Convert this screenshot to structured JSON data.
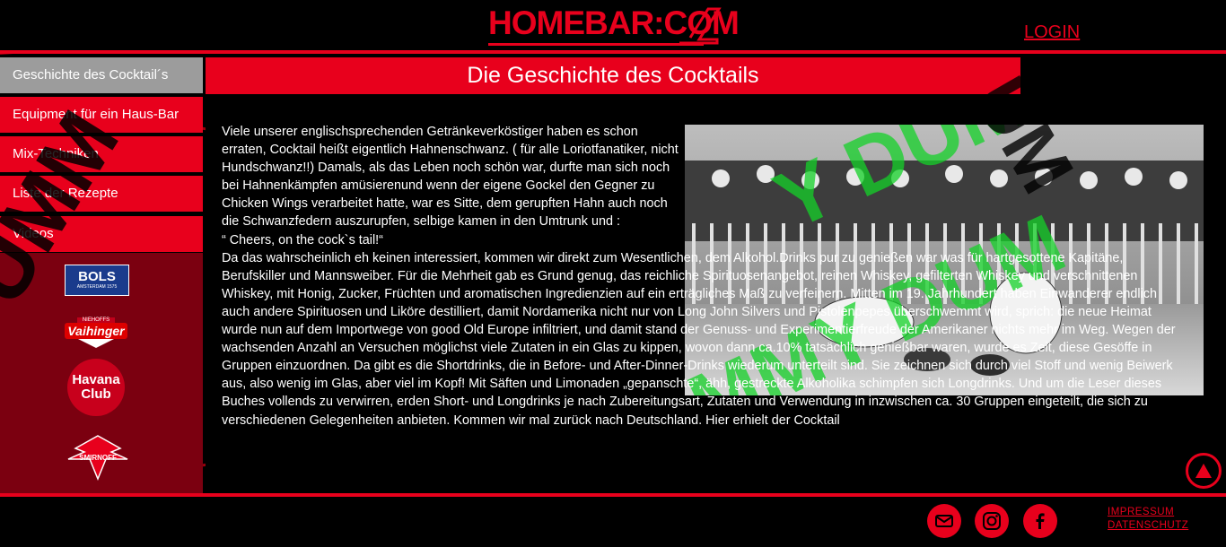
{
  "header": {
    "logo_text": "HOMEBAR:COM",
    "login_label": "LOGIN"
  },
  "sidebar": {
    "items": [
      {
        "label": "Geschichte des Cocktail´s",
        "active": true
      },
      {
        "label": "Equipment für ein Haus-Bar"
      },
      {
        "label": "Mix-Techniken"
      },
      {
        "label": "Liste der Rezepte"
      },
      {
        "label": "Videos"
      }
    ],
    "brands": [
      {
        "name": "bols-logo",
        "text": "BOLS",
        "subtext": "AMSTERDAM 1575"
      },
      {
        "name": "vaihinger-logo",
        "text": "Vaihinger",
        "subtext": "NIEHOFFS"
      },
      {
        "name": "havana-club-logo",
        "text": "Havana Club"
      },
      {
        "name": "smirnoff-logo",
        "text": "SMIRNOFF"
      }
    ]
  },
  "main": {
    "title": "Die Geschichte des Cocktails",
    "paragraphs": [
      "Viele unserer englischsprechenden Getränkeverköstiger haben es schon erraten, Cocktail heißt eigentlich Hahnenschwanz. ( für alle Loriotfanatiker, nicht Hundschwanz!!) Damals, als das Leben noch schön war, durfte man sich noch bei Hahnenkämpfen amüsierenund wenn der eigene Gockel den Gegner zu Chicken Wings verarbeitet hatte, war es Sitte, dem gerupften Hahn auch noch die Schwanzfedern auszurupfen, selbige kamen in den Umtrunk und :",
      "“ Cheers, on the cock`s tail!“",
      "Da das wahrscheinlich eh keinen interessiert, kommen wir direkt zum Wesentlichen, dem Alkohol.Drinks pur zu genießen war was für hartgesottene Kapitäne, Berufskiller und Mannsweiber. Für die Mehrheit gab es Grund genug, das reichliche Spirituosenangebot, reinen Whiskey, gefilterten Whiskey und verschnittenen Whiskey, mit Honig, Zucker, Früchten und aromatischen Ingredienzien auf ein erträgliches Maß zu verfeinern. Mitten im 19. Jahrhundert haben Einwanderer endlich auch andere Spirituosen und Liköre destilliert, damit Nordamerika nicht nur von Long John Silvers und Pistolenpepes überschwemmt wird, sprich: die neue Heimat wurde nun auf dem Importwege von good Old Europe infiltriert, und damit stand der Genuss- und Experimentierfreude der Amerikaner nichts mehr im Weg. Wegen der  wachsenden Anzahl an Versuchen möglichst viele Zutaten in ein Glas zu kippen, wovon dann ca.10% tatsächlich genießbar waren, wurde es Zeit, diese Gesöffe in Gruppen einzuordnen. Da gibt es die Shortdrinks, die in Before- und After-Dinner-Drinks wiederum unterteilt sind. Sie zeichnen sich durch viel Stoff und wenig Beiwerk aus, also wenig  im Glas, aber viel im Kopf! Mit Säften und Limonaden „gepanschte“, ähh, gestreckte Alkoholika schimpfen sich Longdrinks. Und um die Leser dieses Buches vollends zu verwirren, erden Short- und Longdrinks je nach Zubereitungsart, Zutaten und Verwendung in inzwischen ca. 30 Gruppen eingeteilt, die sich zu verschiedenen Gelegenheiten anbieten. Kommen wir mal zurück nach Deutschland. Hier erhielt der Cocktail"
    ],
    "image_alt": "cockfight-photo",
    "watermark_text": "DUMMY"
  },
  "footer": {
    "links": [
      "IMPRESSUM",
      "DATENSCHUTZ"
    ],
    "social": [
      "mail-icon",
      "instagram-icon",
      "facebook-icon"
    ]
  },
  "colors": {
    "accent": "#e8001c",
    "green": "#1fc31f",
    "active_nav": "#9c9c9c"
  }
}
